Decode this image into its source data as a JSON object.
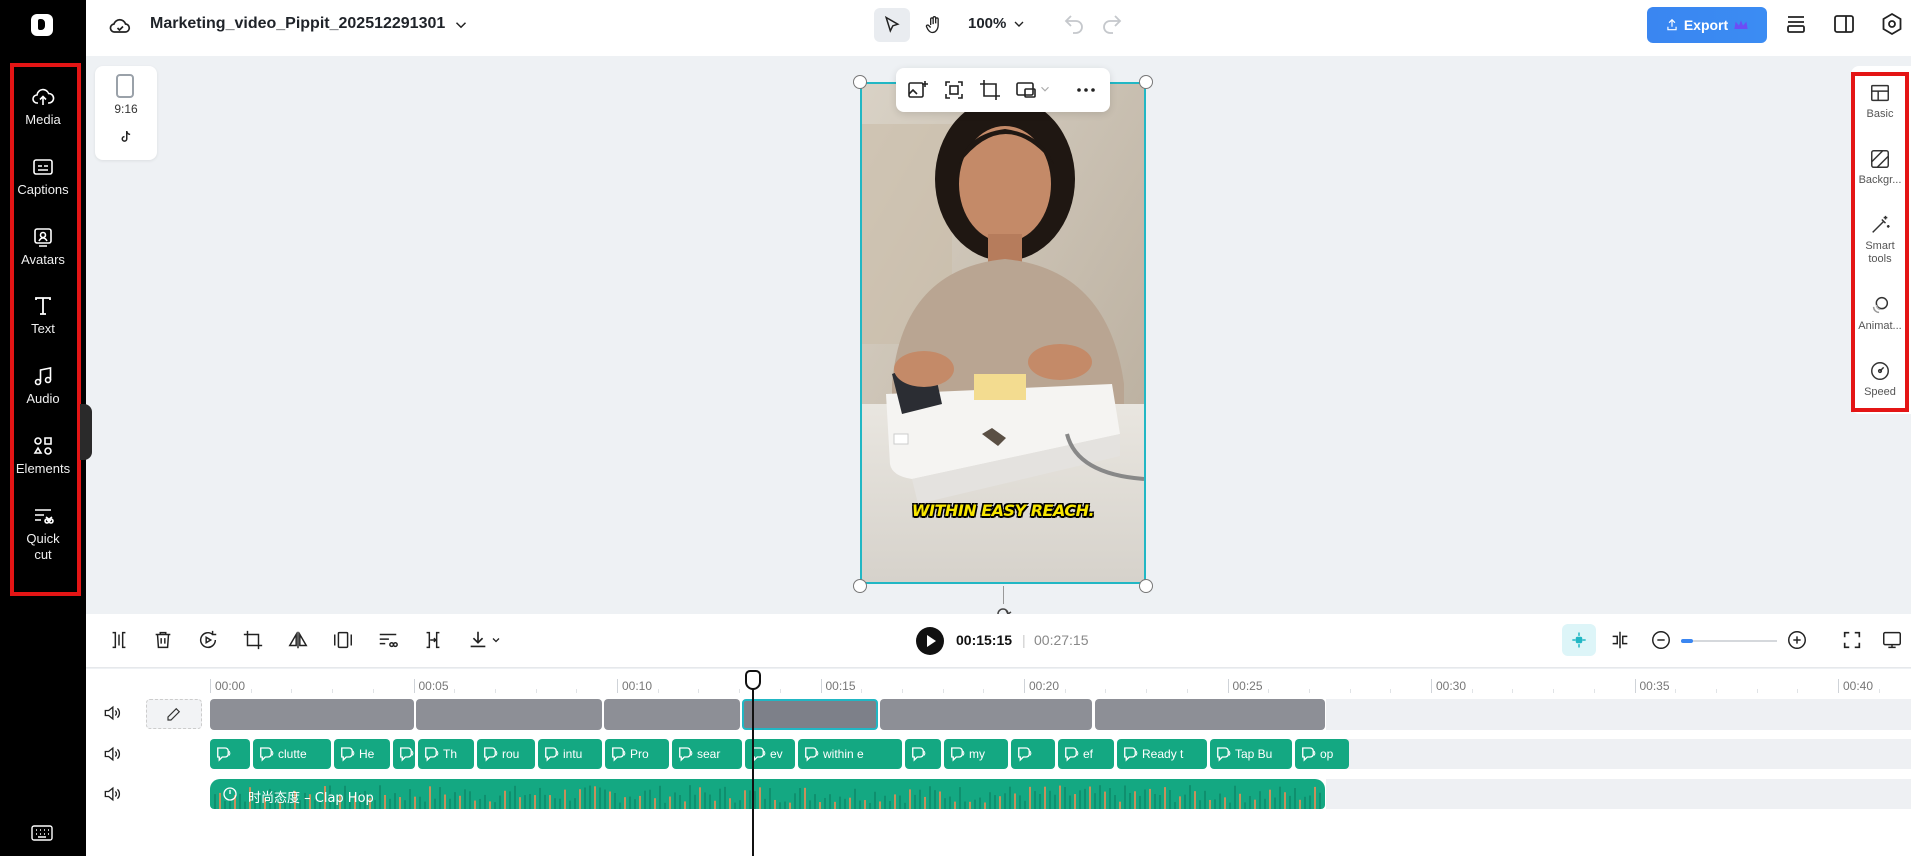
{
  "sidebar": {
    "items": [
      {
        "label": "Media",
        "icon": "cloud-upload-icon"
      },
      {
        "label": "Captions",
        "icon": "captions-icon"
      },
      {
        "label": "Avatars",
        "icon": "avatar-icon"
      },
      {
        "label": "Text",
        "icon": "text-icon"
      },
      {
        "label": "Audio",
        "icon": "music-note-icon"
      },
      {
        "label": "Elements",
        "icon": "elements-icon"
      },
      {
        "label": "Quick\ncut",
        "icon": "quick-cut-icon"
      }
    ]
  },
  "topbar": {
    "project_title": "Marketing_video_Pippit_202512291301",
    "zoom": "100%",
    "export_label": "Export"
  },
  "ratio_card": {
    "ratio": "9:16"
  },
  "canvas": {
    "caption": "WITHIN EASY REACH."
  },
  "right_panel": {
    "items": [
      {
        "label": "Basic",
        "icon": "basic-layout-icon"
      },
      {
        "label": "Backgr...",
        "icon": "background-icon"
      },
      {
        "label": "Smart\ntools",
        "icon": "magic-wand-icon"
      },
      {
        "label": "Animat...",
        "icon": "animation-icon"
      },
      {
        "label": "Speed",
        "icon": "speedometer-icon"
      }
    ]
  },
  "timeline": {
    "current_time": "00:15:15",
    "separator": "|",
    "total_time": "00:27:15",
    "ruler": [
      "00:00",
      "00:05",
      "00:10",
      "00:15",
      "00:20",
      "00:25",
      "00:30",
      "00:35",
      "00:40"
    ],
    "caption_clips": [
      "",
      "clutte",
      "He",
      "",
      "Th",
      "rou",
      "intu",
      "Pro",
      "sear",
      "ev",
      "within e",
      "",
      "my",
      "",
      "ef",
      "Ready t",
      "Tap Bu",
      "op"
    ],
    "audio_label": "时尚态度 – Clap Hop"
  },
  "colors": {
    "accent": "#3a86f1",
    "selection": "#21b7c4",
    "clip_green": "#14a882",
    "highlight_red": "#e41515"
  }
}
